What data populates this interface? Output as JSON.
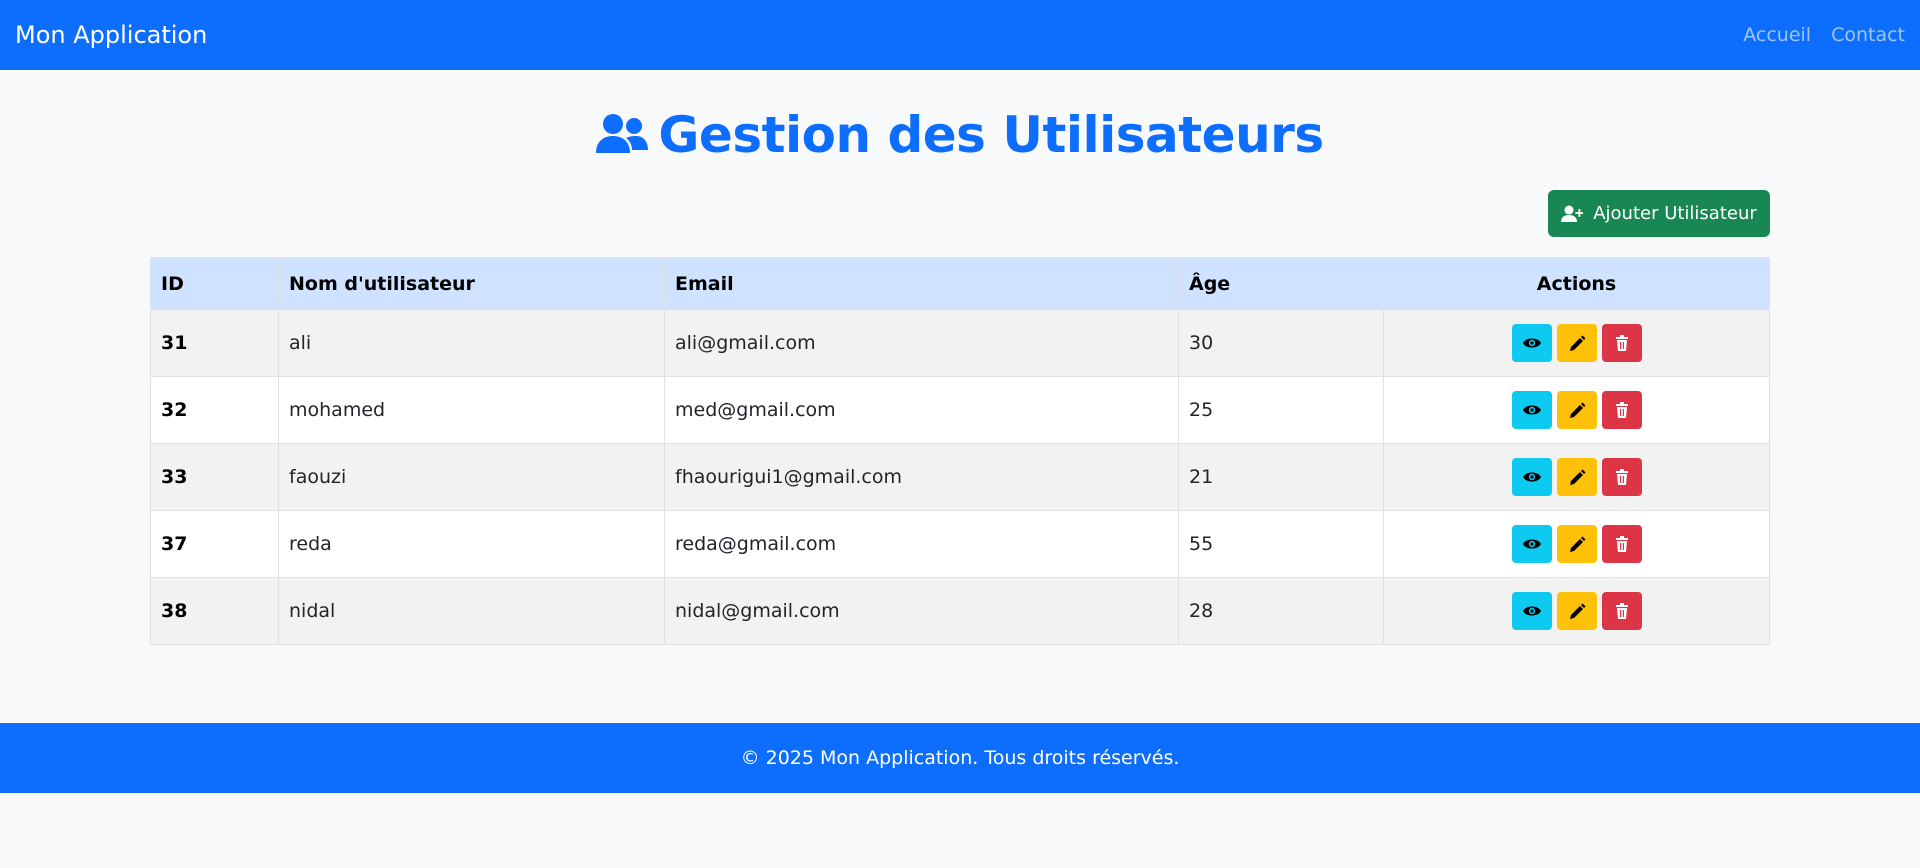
{
  "navbar": {
    "brand": "Mon Application",
    "links": [
      "Accueil",
      "Contact"
    ]
  },
  "page": {
    "title": "Gestion des Utilisateurs",
    "title_icon": "users-icon",
    "add_button_label": "Ajouter Utilisateur",
    "add_button_icon": "user-plus-icon"
  },
  "table": {
    "headers": [
      "ID",
      "Nom d'utilisateur",
      "Email",
      "Âge",
      "Actions"
    ],
    "rows": [
      {
        "id": "31",
        "username": "ali",
        "email": "ali@gmail.com",
        "age": "30"
      },
      {
        "id": "32",
        "username": "mohamed",
        "email": "med@gmail.com",
        "age": "25"
      },
      {
        "id": "33",
        "username": "faouzi",
        "email": "fhaourigui1@gmail.com",
        "age": "21"
      },
      {
        "id": "37",
        "username": "reda",
        "email": "reda@gmail.com",
        "age": "55"
      },
      {
        "id": "38",
        "username": "nidal",
        "email": "nidal@gmail.com",
        "age": "28"
      }
    ],
    "action_icons": [
      "eye-icon",
      "pencil-icon",
      "trash-icon"
    ]
  },
  "footer": {
    "text": "© 2025 Mon Application. Tous droits réservés."
  },
  "colors": {
    "primary": "#0d6efd",
    "success": "#198754",
    "info": "#0dcaf0",
    "warning": "#ffc107",
    "danger": "#dc3545",
    "table_head": "#cfe2ff"
  }
}
